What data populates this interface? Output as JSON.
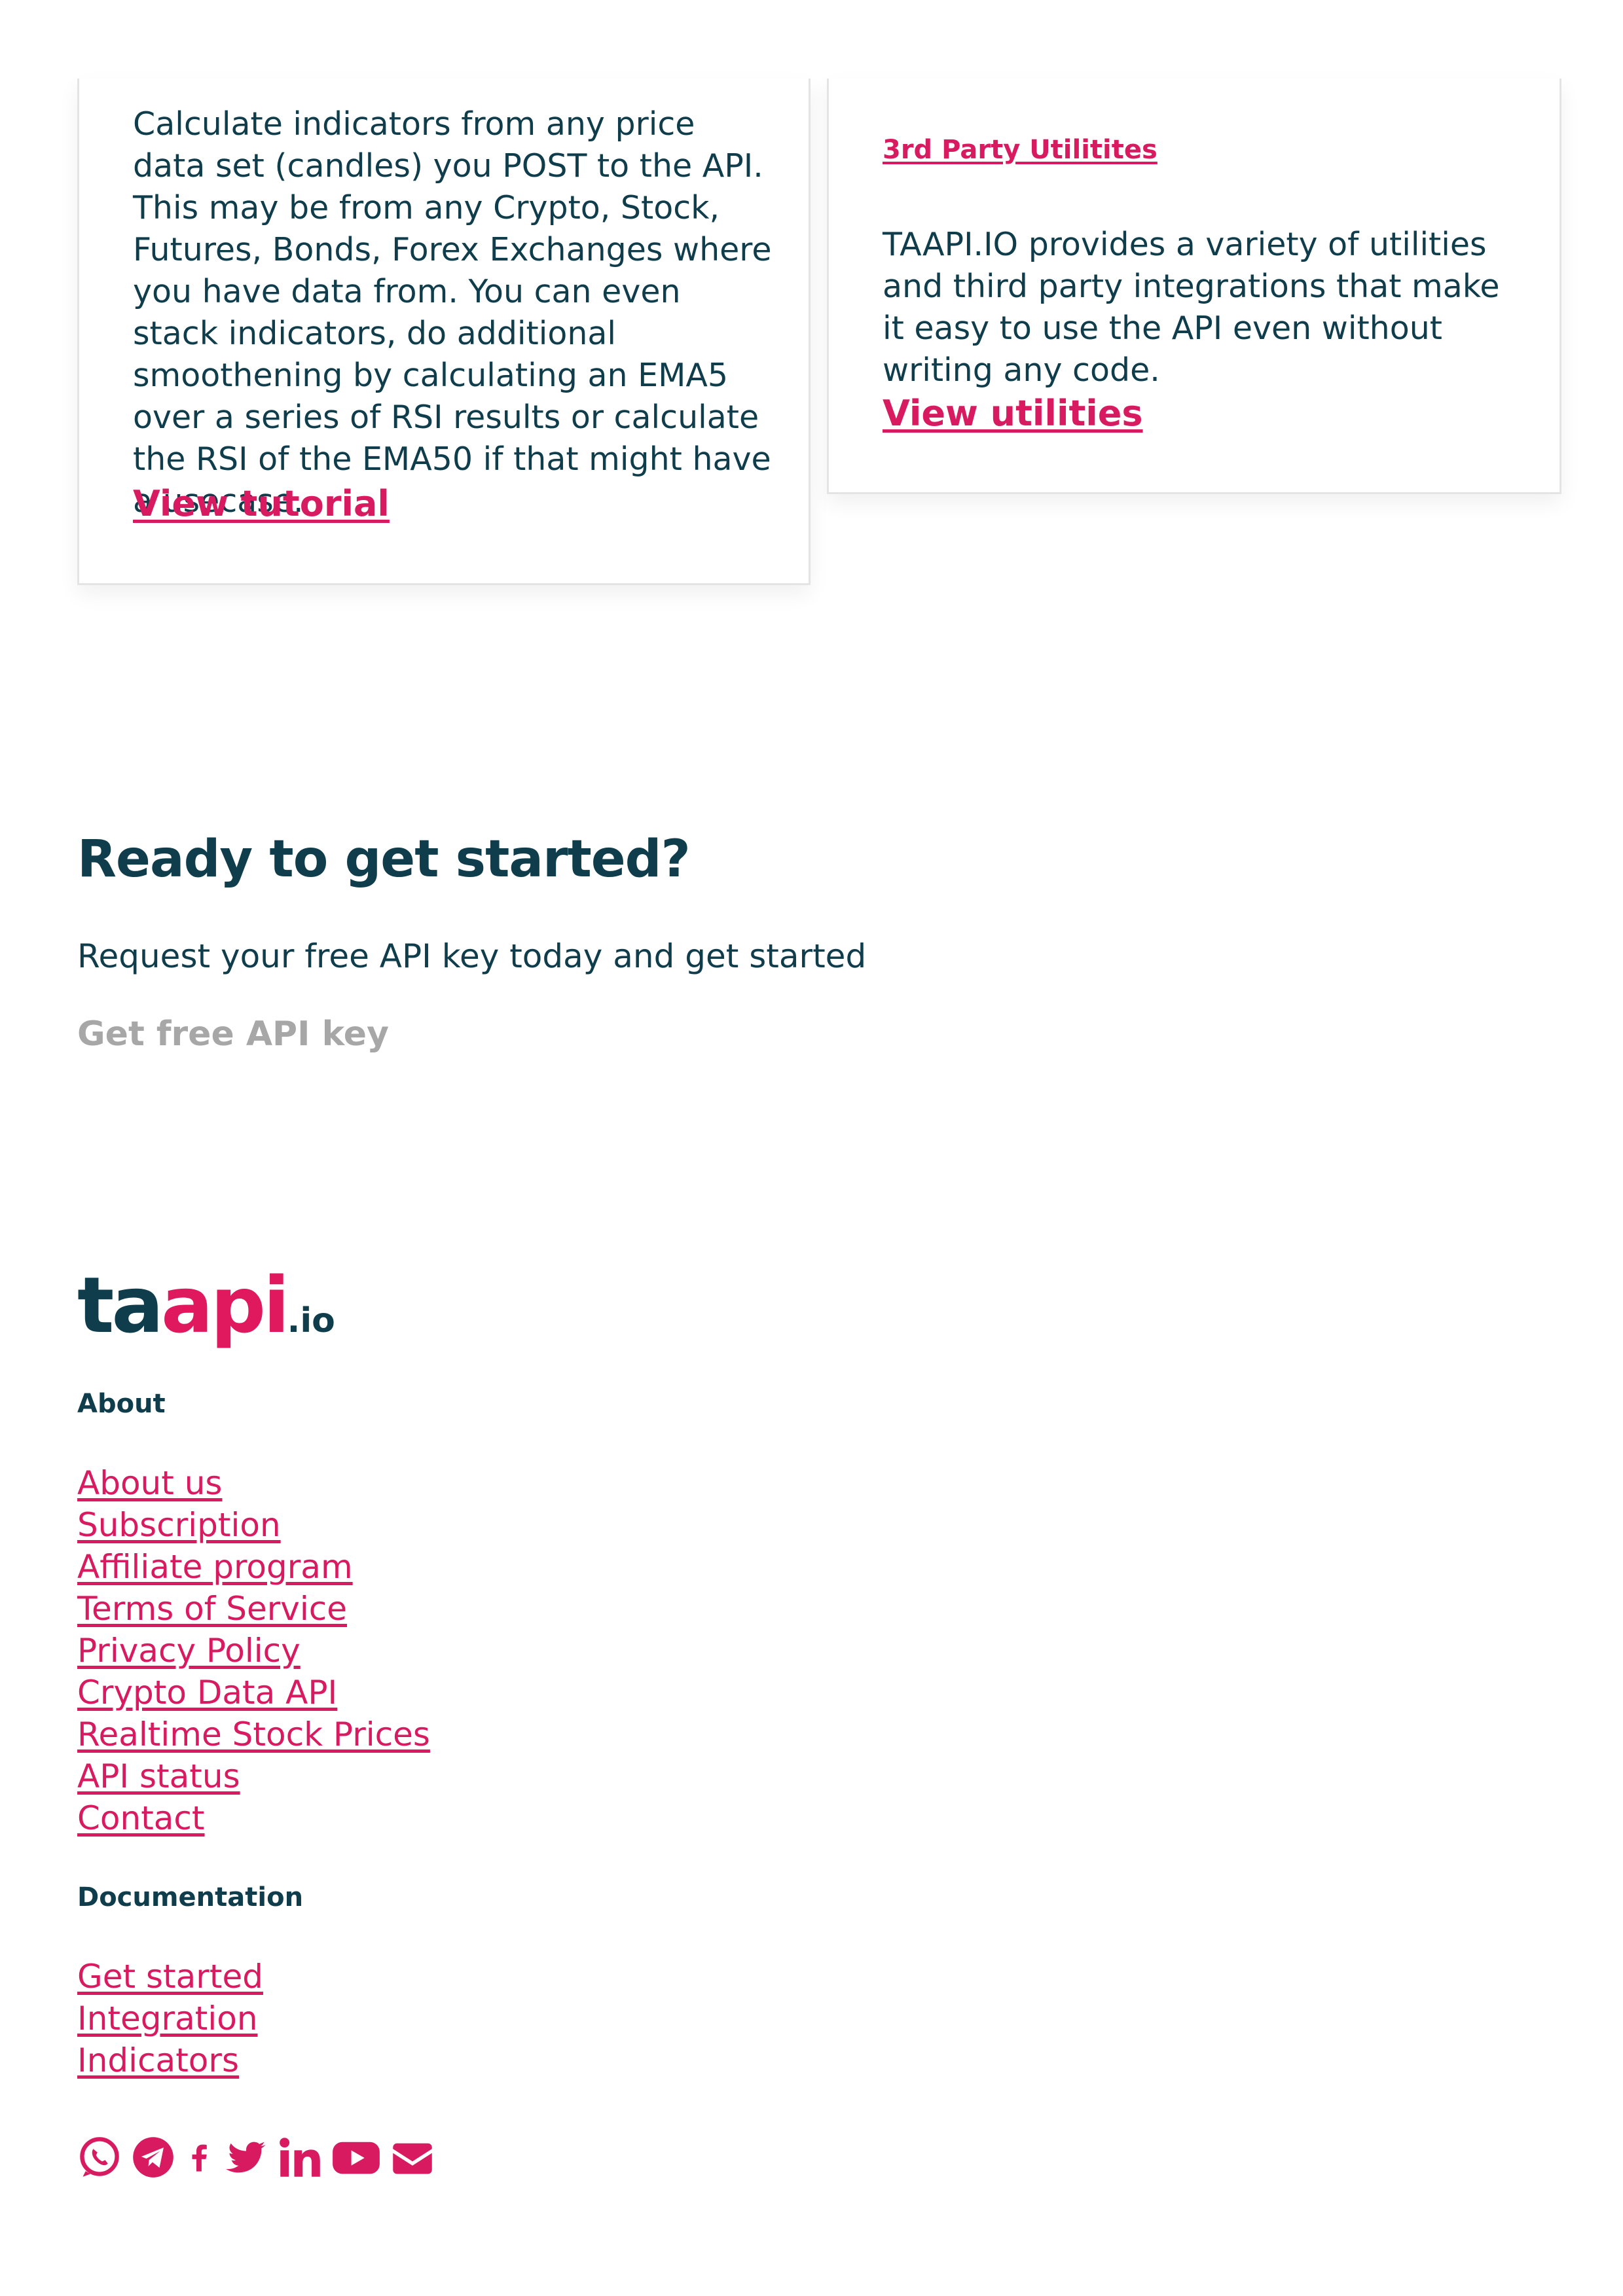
{
  "cards": {
    "left": {
      "text": "Calculate indicators from any price data set (candles) you POST to the API. This may be from any Crypto, Stock, Futures, Bonds, Forex Exchanges where you have data from. You can even stack indicators, do additional smoothening by calculating an EMA5 over a series of RSI results or calculate the RSI of the EMA50 if that might have a usecase.",
      "link": "View tutorial"
    },
    "right": {
      "heading": "3rd Party Utilitites",
      "text": "TAAPI.IO provides a variety of utilities and third party integrations that make it easy to use the API even without writing any code.",
      "link": "View utilities"
    }
  },
  "cta": {
    "title": "Ready to get started?",
    "subtitle": "Request your free API key today and get started",
    "button": "Get free API key"
  },
  "footer": {
    "logo": {
      "part1": "ta",
      "part2": "api",
      "part3": ".io"
    },
    "about": {
      "heading": "About",
      "links": [
        "About us",
        "Subscription",
        "Affiliate program",
        "Terms of Service",
        "Privacy Policy",
        "Crypto Data API",
        "Realtime Stock Prices",
        "API status",
        "Contact"
      ]
    },
    "documentation": {
      "heading": "Documentation",
      "links": [
        "Get started",
        "Integration",
        "Indicators"
      ]
    },
    "social": [
      "whatsapp-icon",
      "telegram-icon",
      "facebook-icon",
      "twitter-icon",
      "linkedin-icon",
      "youtube-icon",
      "envelope-icon"
    ]
  },
  "colors": {
    "text": "#0f3d4c",
    "accent": "#d81b60",
    "muted": "#a7a7a7"
  }
}
